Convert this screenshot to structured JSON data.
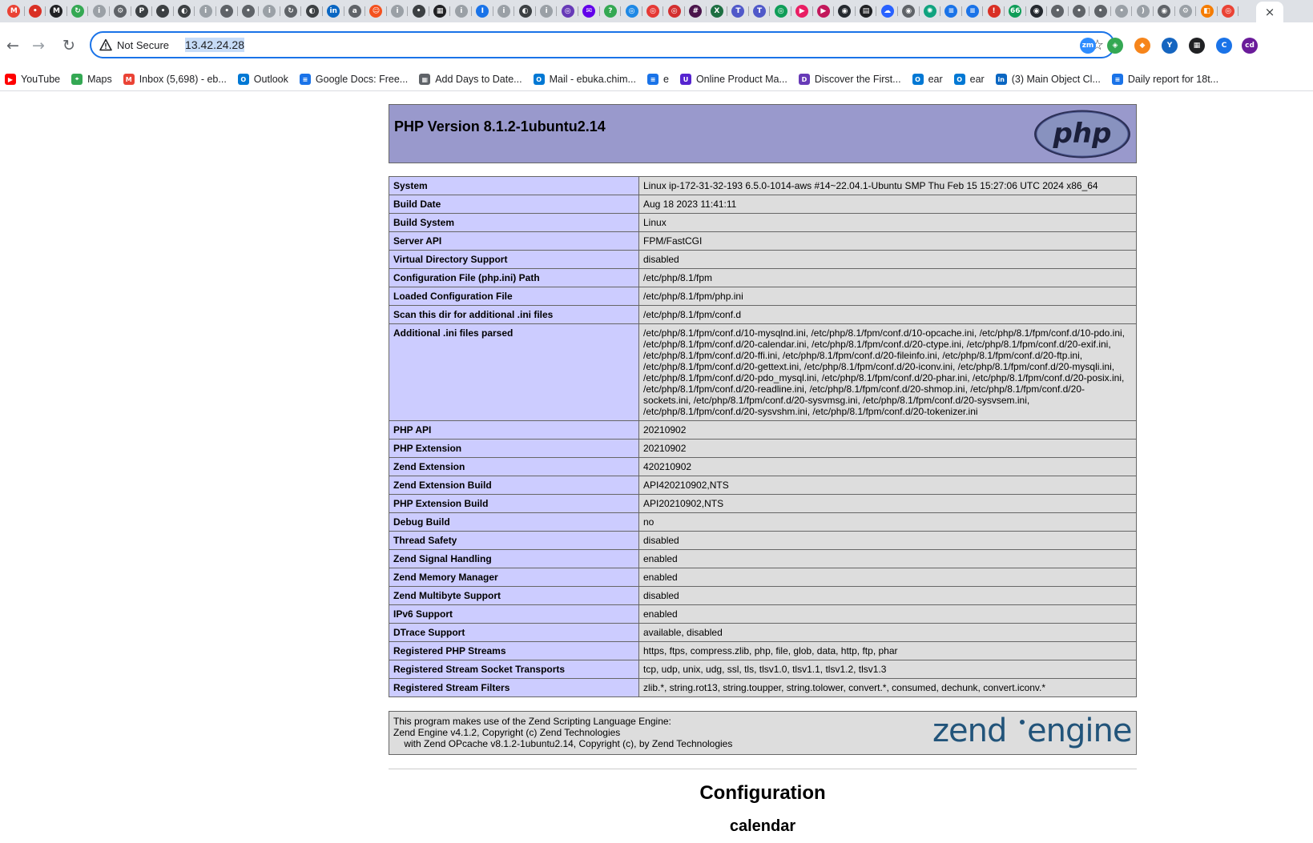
{
  "browser": {
    "tab_favicons": [
      {
        "name": "gmail-icon",
        "color": "#ea4335",
        "glyph": "M"
      },
      {
        "name": "red-circle-icon",
        "color": "#d93025",
        "glyph": "•"
      },
      {
        "name": "site-icon",
        "color": "#202124",
        "glyph": "M"
      },
      {
        "name": "refresh-site-icon",
        "color": "#34a853",
        "glyph": "↻"
      },
      {
        "name": "info-icon",
        "color": "#9aa0a6",
        "glyph": "i"
      },
      {
        "name": "settings-site-icon",
        "color": "#5f6368",
        "glyph": "⚙"
      },
      {
        "name": "p-site-icon",
        "color": "#3c4043",
        "glyph": "P"
      },
      {
        "name": "dark-site-icon",
        "color": "#3c4043",
        "glyph": "•"
      },
      {
        "name": "globe-icon",
        "color": "#3c4043",
        "glyph": "◐"
      },
      {
        "name": "info-icon",
        "color": "#9aa0a6",
        "glyph": "i"
      },
      {
        "name": "dark-site-icon",
        "color": "#5f6368",
        "glyph": "•"
      },
      {
        "name": "dark-site-icon",
        "color": "#5f6368",
        "glyph": "•"
      },
      {
        "name": "info-icon",
        "color": "#9aa0a6",
        "glyph": "i"
      },
      {
        "name": "refresh-site-icon",
        "color": "#5f6368",
        "glyph": "↻"
      },
      {
        "name": "globe-icon",
        "color": "#3c4043",
        "glyph": "◐"
      },
      {
        "name": "linkedin-icon",
        "color": "#0a66c2",
        "glyph": "in"
      },
      {
        "name": "lock-site-icon",
        "color": "#5f6368",
        "glyph": "a"
      },
      {
        "name": "face-icon",
        "color": "#f4511e",
        "glyph": "☺"
      },
      {
        "name": "info-icon",
        "color": "#9aa0a6",
        "glyph": "i"
      },
      {
        "name": "dark-site-icon",
        "color": "#3c4043",
        "glyph": "•"
      },
      {
        "name": "grid-site-icon",
        "color": "#202124",
        "glyph": "▦"
      },
      {
        "name": "info-icon",
        "color": "#9aa0a6",
        "glyph": "i"
      },
      {
        "name": "info-blue-icon",
        "color": "#1a73e8",
        "glyph": "I"
      },
      {
        "name": "info-icon",
        "color": "#9aa0a6",
        "glyph": "i"
      },
      {
        "name": "globe-icon",
        "color": "#3c4043",
        "glyph": "◐"
      },
      {
        "name": "info-icon",
        "color": "#9aa0a6",
        "glyph": "i"
      },
      {
        "name": "purple-site-icon",
        "color": "#673ab7",
        "glyph": "◎"
      },
      {
        "name": "mail-icon",
        "color": "#6200ea",
        "glyph": "✉"
      },
      {
        "name": "maps-site-icon",
        "color": "#34a853",
        "glyph": "?"
      },
      {
        "name": "blue-site-icon",
        "color": "#1e88e5",
        "glyph": "◎"
      },
      {
        "name": "red-site-icon",
        "color": "#e53935",
        "glyph": "◎"
      },
      {
        "name": "red-site-icon",
        "color": "#d32f2f",
        "glyph": "◎"
      },
      {
        "name": "slack-icon",
        "color": "#4a154b",
        "glyph": "#"
      },
      {
        "name": "excel-icon",
        "color": "#1d6f42",
        "glyph": "X"
      },
      {
        "name": "teams-icon",
        "color": "#5059c9",
        "glyph": "T"
      },
      {
        "name": "teams-icon",
        "color": "#5059c9",
        "glyph": "T"
      },
      {
        "name": "green-site-icon",
        "color": "#0f9d58",
        "glyph": "◎"
      },
      {
        "name": "play-icon",
        "color": "#e91e63",
        "glyph": "▶"
      },
      {
        "name": "play-icon",
        "color": "#c2185b",
        "glyph": "▶"
      },
      {
        "name": "github-icon",
        "color": "#24292f",
        "glyph": "◉"
      },
      {
        "name": "film-icon",
        "color": "#202124",
        "glyph": "▤"
      },
      {
        "name": "blue-cloud-icon",
        "color": "#2962ff",
        "glyph": "☁"
      },
      {
        "name": "github-icon",
        "color": "#5f6368",
        "glyph": "◉"
      },
      {
        "name": "chatgpt-icon",
        "color": "#10a37f",
        "glyph": "✺"
      },
      {
        "name": "docs-icon",
        "color": "#1a73e8",
        "glyph": "≡"
      },
      {
        "name": "docs-icon",
        "color": "#1a73e8",
        "glyph": "≡"
      },
      {
        "name": "alert-icon",
        "color": "#d93025",
        "glyph": "!"
      },
      {
        "name": "green-badge-icon",
        "color": "#0f9d58",
        "glyph": "66"
      },
      {
        "name": "github-icon",
        "color": "#24292f",
        "glyph": "◉"
      },
      {
        "name": "dark-site-icon",
        "color": "#5f6368",
        "glyph": "•"
      },
      {
        "name": "dark-site-icon",
        "color": "#5f6368",
        "glyph": "•"
      },
      {
        "name": "dark-site-icon",
        "color": "#5f6368",
        "glyph": "•"
      },
      {
        "name": "gray-site-icon",
        "color": "#9aa0a6",
        "glyph": "•"
      },
      {
        "name": "moon-icon",
        "color": "#9aa0a6",
        "glyph": ")"
      },
      {
        "name": "github-icon",
        "color": "#5f6368",
        "glyph": "◉"
      },
      {
        "name": "settings-site-icon",
        "color": "#9aa0a6",
        "glyph": "⚙"
      },
      {
        "name": "orange-site-icon",
        "color": "#f57c00",
        "glyph": "◧"
      },
      {
        "name": "red-site-icon",
        "color": "#ea4335",
        "glyph": "◎"
      }
    ],
    "active_tab_close": "×",
    "nav": {
      "back": "←",
      "forward": "→",
      "reload": "↻"
    },
    "omnibox": {
      "security_label": "Not Secure",
      "url": "13.42.24.28",
      "bookmark_star": "☆"
    },
    "extensions": [
      {
        "name": "zoom-extension-icon",
        "color": "#2d8cff",
        "glyph": "zm"
      },
      {
        "name": "green-extension-icon",
        "color": "#34a853",
        "glyph": "◈"
      },
      {
        "name": "metamask-extension-icon",
        "color": "#f6851b",
        "glyph": "◆"
      },
      {
        "name": "blue-v-extension-icon",
        "color": "#1565c0",
        "glyph": "Y"
      },
      {
        "name": "grid-extension-icon",
        "color": "#202124",
        "glyph": "▦"
      },
      {
        "name": "c-extension-icon",
        "color": "#1a73e8",
        "glyph": "C"
      },
      {
        "name": "purple-extension-icon",
        "color": "#6a1b9a",
        "glyph": "cd"
      }
    ],
    "bookmarks": [
      {
        "name": "youtube-icon",
        "color": "#ff0000",
        "glyph": "▶",
        "label": "YouTube"
      },
      {
        "name": "maps-icon",
        "color": "#34a853",
        "glyph": "⌖",
        "label": "Maps"
      },
      {
        "name": "gmail-icon",
        "color": "#ea4335",
        "glyph": "M",
        "label": "Inbox (5,698) - eb..."
      },
      {
        "name": "outlook-icon",
        "color": "#0078d4",
        "glyph": "O",
        "label": "Outlook"
      },
      {
        "name": "docs-icon",
        "color": "#1a73e8",
        "glyph": "≡",
        "label": "Google Docs: Free..."
      },
      {
        "name": "calendar-grid-icon",
        "color": "#5f6368",
        "glyph": "▦",
        "label": "Add Days to Date..."
      },
      {
        "name": "outlook-icon",
        "color": "#0078d4",
        "glyph": "O",
        "label": "Mail - ebuka.chim..."
      },
      {
        "name": "docs-icon",
        "color": "#1a73e8",
        "glyph": "≡",
        "label": "e"
      },
      {
        "name": "udemy-icon",
        "color": "#5624d0",
        "glyph": "U",
        "label": "Online Product Ma..."
      },
      {
        "name": "discover-icon",
        "color": "#673ab7",
        "glyph": "D",
        "label": "Discover the First..."
      },
      {
        "name": "outlook-icon",
        "color": "#0078d4",
        "glyph": "O",
        "label": "ear"
      },
      {
        "name": "outlook-icon",
        "color": "#0078d4",
        "glyph": "O",
        "label": "ear"
      },
      {
        "name": "linkedin-icon",
        "color": "#0a66c2",
        "glyph": "in",
        "label": "(3) Main Object Cl..."
      },
      {
        "name": "docs-icon",
        "color": "#1a73e8",
        "glyph": "≡",
        "label": "Daily report for 18t..."
      }
    ]
  },
  "phpinfo": {
    "title": "PHP Version 8.1.2-1ubuntu2.14",
    "logo_text": "php",
    "rows": [
      {
        "key": "System",
        "value": "Linux ip-172-31-32-193 6.5.0-1014-aws #14~22.04.1-Ubuntu SMP Thu Feb 15 15:27:06 UTC 2024 x86_64"
      },
      {
        "key": "Build Date",
        "value": "Aug 18 2023 11:41:11"
      },
      {
        "key": "Build System",
        "value": "Linux"
      },
      {
        "key": "Server API",
        "value": "FPM/FastCGI"
      },
      {
        "key": "Virtual Directory Support",
        "value": "disabled"
      },
      {
        "key": "Configuration File (php.ini) Path",
        "value": "/etc/php/8.1/fpm"
      },
      {
        "key": "Loaded Configuration File",
        "value": "/etc/php/8.1/fpm/php.ini"
      },
      {
        "key": "Scan this dir for additional .ini files",
        "value": "/etc/php/8.1/fpm/conf.d"
      },
      {
        "key": "Additional .ini files parsed",
        "value": "/etc/php/8.1/fpm/conf.d/10-mysqlnd.ini, /etc/php/8.1/fpm/conf.d/10-opcache.ini, /etc/php/8.1/fpm/conf.d/10-pdo.ini, /etc/php/8.1/fpm/conf.d/20-calendar.ini, /etc/php/8.1/fpm/conf.d/20-ctype.ini, /etc/php/8.1/fpm/conf.d/20-exif.ini, /etc/php/8.1/fpm/conf.d/20-ffi.ini, /etc/php/8.1/fpm/conf.d/20-fileinfo.ini, /etc/php/8.1/fpm/conf.d/20-ftp.ini, /etc/php/8.1/fpm/conf.d/20-gettext.ini, /etc/php/8.1/fpm/conf.d/20-iconv.ini, /etc/php/8.1/fpm/conf.d/20-mysqli.ini, /etc/php/8.1/fpm/conf.d/20-pdo_mysql.ini, /etc/php/8.1/fpm/conf.d/20-phar.ini, /etc/php/8.1/fpm/conf.d/20-posix.ini, /etc/php/8.1/fpm/conf.d/20-readline.ini, /etc/php/8.1/fpm/conf.d/20-shmop.ini, /etc/php/8.1/fpm/conf.d/20-sockets.ini, /etc/php/8.1/fpm/conf.d/20-sysvmsg.ini, /etc/php/8.1/fpm/conf.d/20-sysvsem.ini, /etc/php/8.1/fpm/conf.d/20-sysvshm.ini, /etc/php/8.1/fpm/conf.d/20-tokenizer.ini"
      },
      {
        "key": "PHP API",
        "value": "20210902"
      },
      {
        "key": "PHP Extension",
        "value": "20210902"
      },
      {
        "key": "Zend Extension",
        "value": "420210902"
      },
      {
        "key": "Zend Extension Build",
        "value": "API420210902,NTS"
      },
      {
        "key": "PHP Extension Build",
        "value": "API20210902,NTS"
      },
      {
        "key": "Debug Build",
        "value": "no"
      },
      {
        "key": "Thread Safety",
        "value": "disabled"
      },
      {
        "key": "Zend Signal Handling",
        "value": "enabled"
      },
      {
        "key": "Zend Memory Manager",
        "value": "enabled"
      },
      {
        "key": "Zend Multibyte Support",
        "value": "disabled"
      },
      {
        "key": "IPv6 Support",
        "value": "enabled"
      },
      {
        "key": "DTrace Support",
        "value": "available, disabled"
      },
      {
        "key": "Registered PHP Streams",
        "value": "https, ftps, compress.zlib, php, file, glob, data, http, ftp, phar"
      },
      {
        "key": "Registered Stream Socket Transports",
        "value": "tcp, udp, unix, udg, ssl, tls, tlsv1.0, tlsv1.1, tlsv1.2, tlsv1.3"
      },
      {
        "key": "Registered Stream Filters",
        "value": "zlib.*, string.rot13, string.toupper, string.tolower, convert.*, consumed, dechunk, convert.iconv.*"
      }
    ],
    "zend": {
      "line1": "This program makes use of the Zend Scripting Language Engine:",
      "line2": "Zend Engine v4.1.2, Copyright (c) Zend Technologies",
      "line3": "    with Zend OPcache v8.1.2-1ubuntu2.14, Copyright (c), by Zend Technologies",
      "logo_word1": "zend",
      "logo_word2": "engine"
    },
    "section_heading": "Configuration",
    "subsection_heading": "calendar"
  }
}
